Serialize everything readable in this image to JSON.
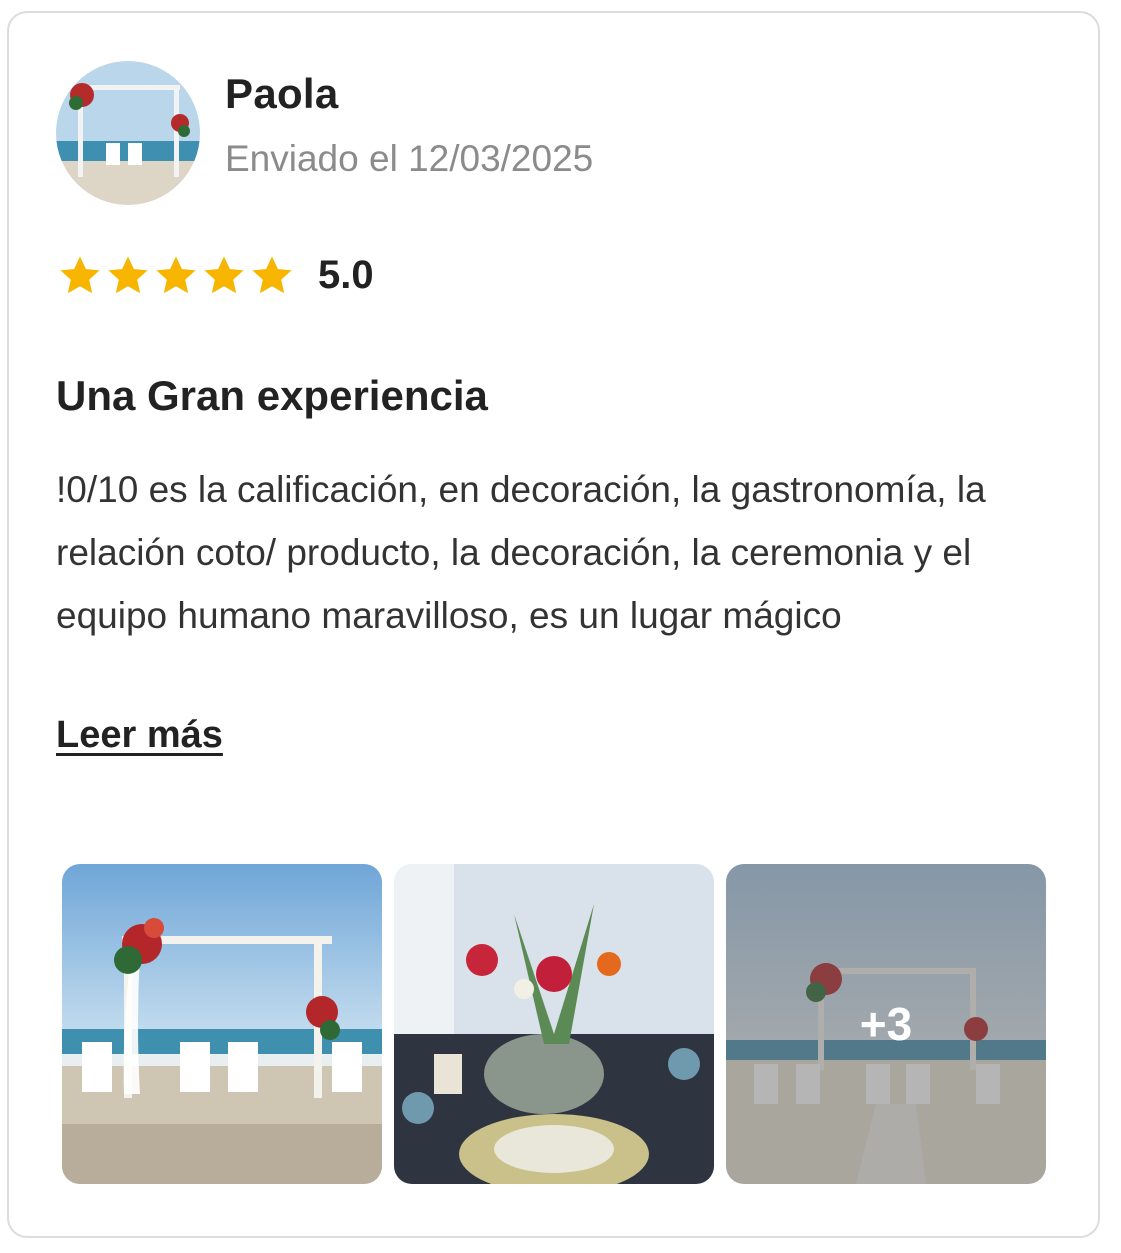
{
  "review": {
    "author": "Paola",
    "date": "Enviado el 12/03/2025",
    "rating": 5,
    "rating_text": "5.0",
    "title": "Una Gran experiencia",
    "body": "!0/10 es la calificación, en decoración, la gastronomía, la relación coto/ producto, la decoración, la ceremonia y el equipo humano maravilloso, es un lugar mágico",
    "read_more": "Leer más"
  },
  "gallery": {
    "photos": [
      {
        "icon": "beach-wedding-arch-photo"
      },
      {
        "icon": "table-centerpiece-photo"
      },
      {
        "icon": "beach-ceremony-photo"
      }
    ],
    "more_count": "+3"
  },
  "colors": {
    "star": "#f7b500",
    "text": "#222222",
    "muted": "#8b8b8b",
    "border": "#dcdcdc"
  }
}
